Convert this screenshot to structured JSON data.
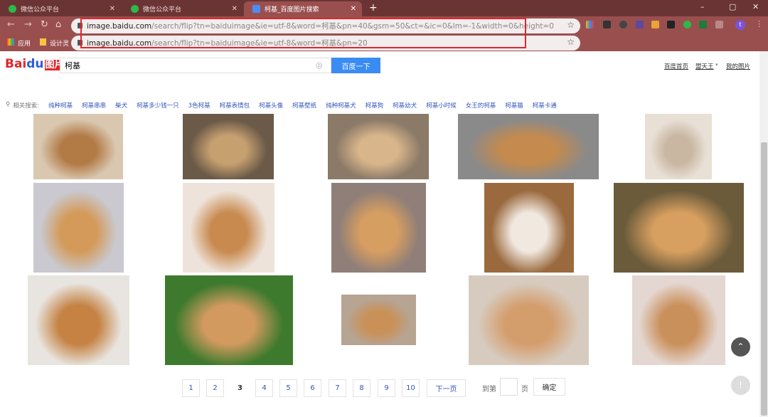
{
  "browser": {
    "tabs": [
      {
        "title": "微信公众平台",
        "icon": "wechat-icon"
      },
      {
        "title": "微信公众平台",
        "icon": "wechat-icon"
      },
      {
        "title": "柯基_百度图片搜索",
        "icon": "baidu-paw-icon",
        "active": true
      }
    ],
    "new_tab": "+",
    "window_controls": {
      "minimize": "–",
      "maximize": "▢",
      "close": "✕"
    },
    "url_domain": "image.baidu.com",
    "url_path": "/search/flip?tn=baiduimage&ie=utf-8&word=柯基&pn=40&gsm=50&ct=&ic=0&lm=-1&width=0&height=0",
    "url2_domain": "image.baidu.com",
    "url2_path": "/search/flip?tn=baiduimage&ie=utf-8&word=柯基&pn=20",
    "bookmarks": [
      {
        "label": "应用",
        "icon": "apps-icon"
      },
      {
        "label": "设计灵",
        "icon": "folder-icon"
      }
    ],
    "profile": "t",
    "highlight_color": "#e0262c"
  },
  "page": {
    "logo": "Bai du 图片",
    "search_value": "柯基",
    "search_button": "百度一下",
    "top_links": [
      "百度首页",
      "盟天王",
      "我的图片"
    ],
    "related_label": "相关搜索:",
    "related": [
      "纯种柯基",
      "柯基串串",
      "柴犬",
      "柯基多少钱一只",
      "3色柯基",
      "柯基表情包",
      "柯基头像",
      "柯基壁纸",
      "纯种柯基犬",
      "柯基狗",
      "柯基幼犬",
      "柯基小时候",
      "女王的柯基",
      "柯基猫",
      "柯基卡通"
    ],
    "pages": [
      "1",
      "2",
      "3",
      "4",
      "5",
      "6",
      "7",
      "8",
      "9",
      "10"
    ],
    "current_page": "3",
    "next": "下一页",
    "goto_label": "到第",
    "page_unit": "页",
    "confirm": "确定",
    "accent": "#3a8cf3"
  }
}
